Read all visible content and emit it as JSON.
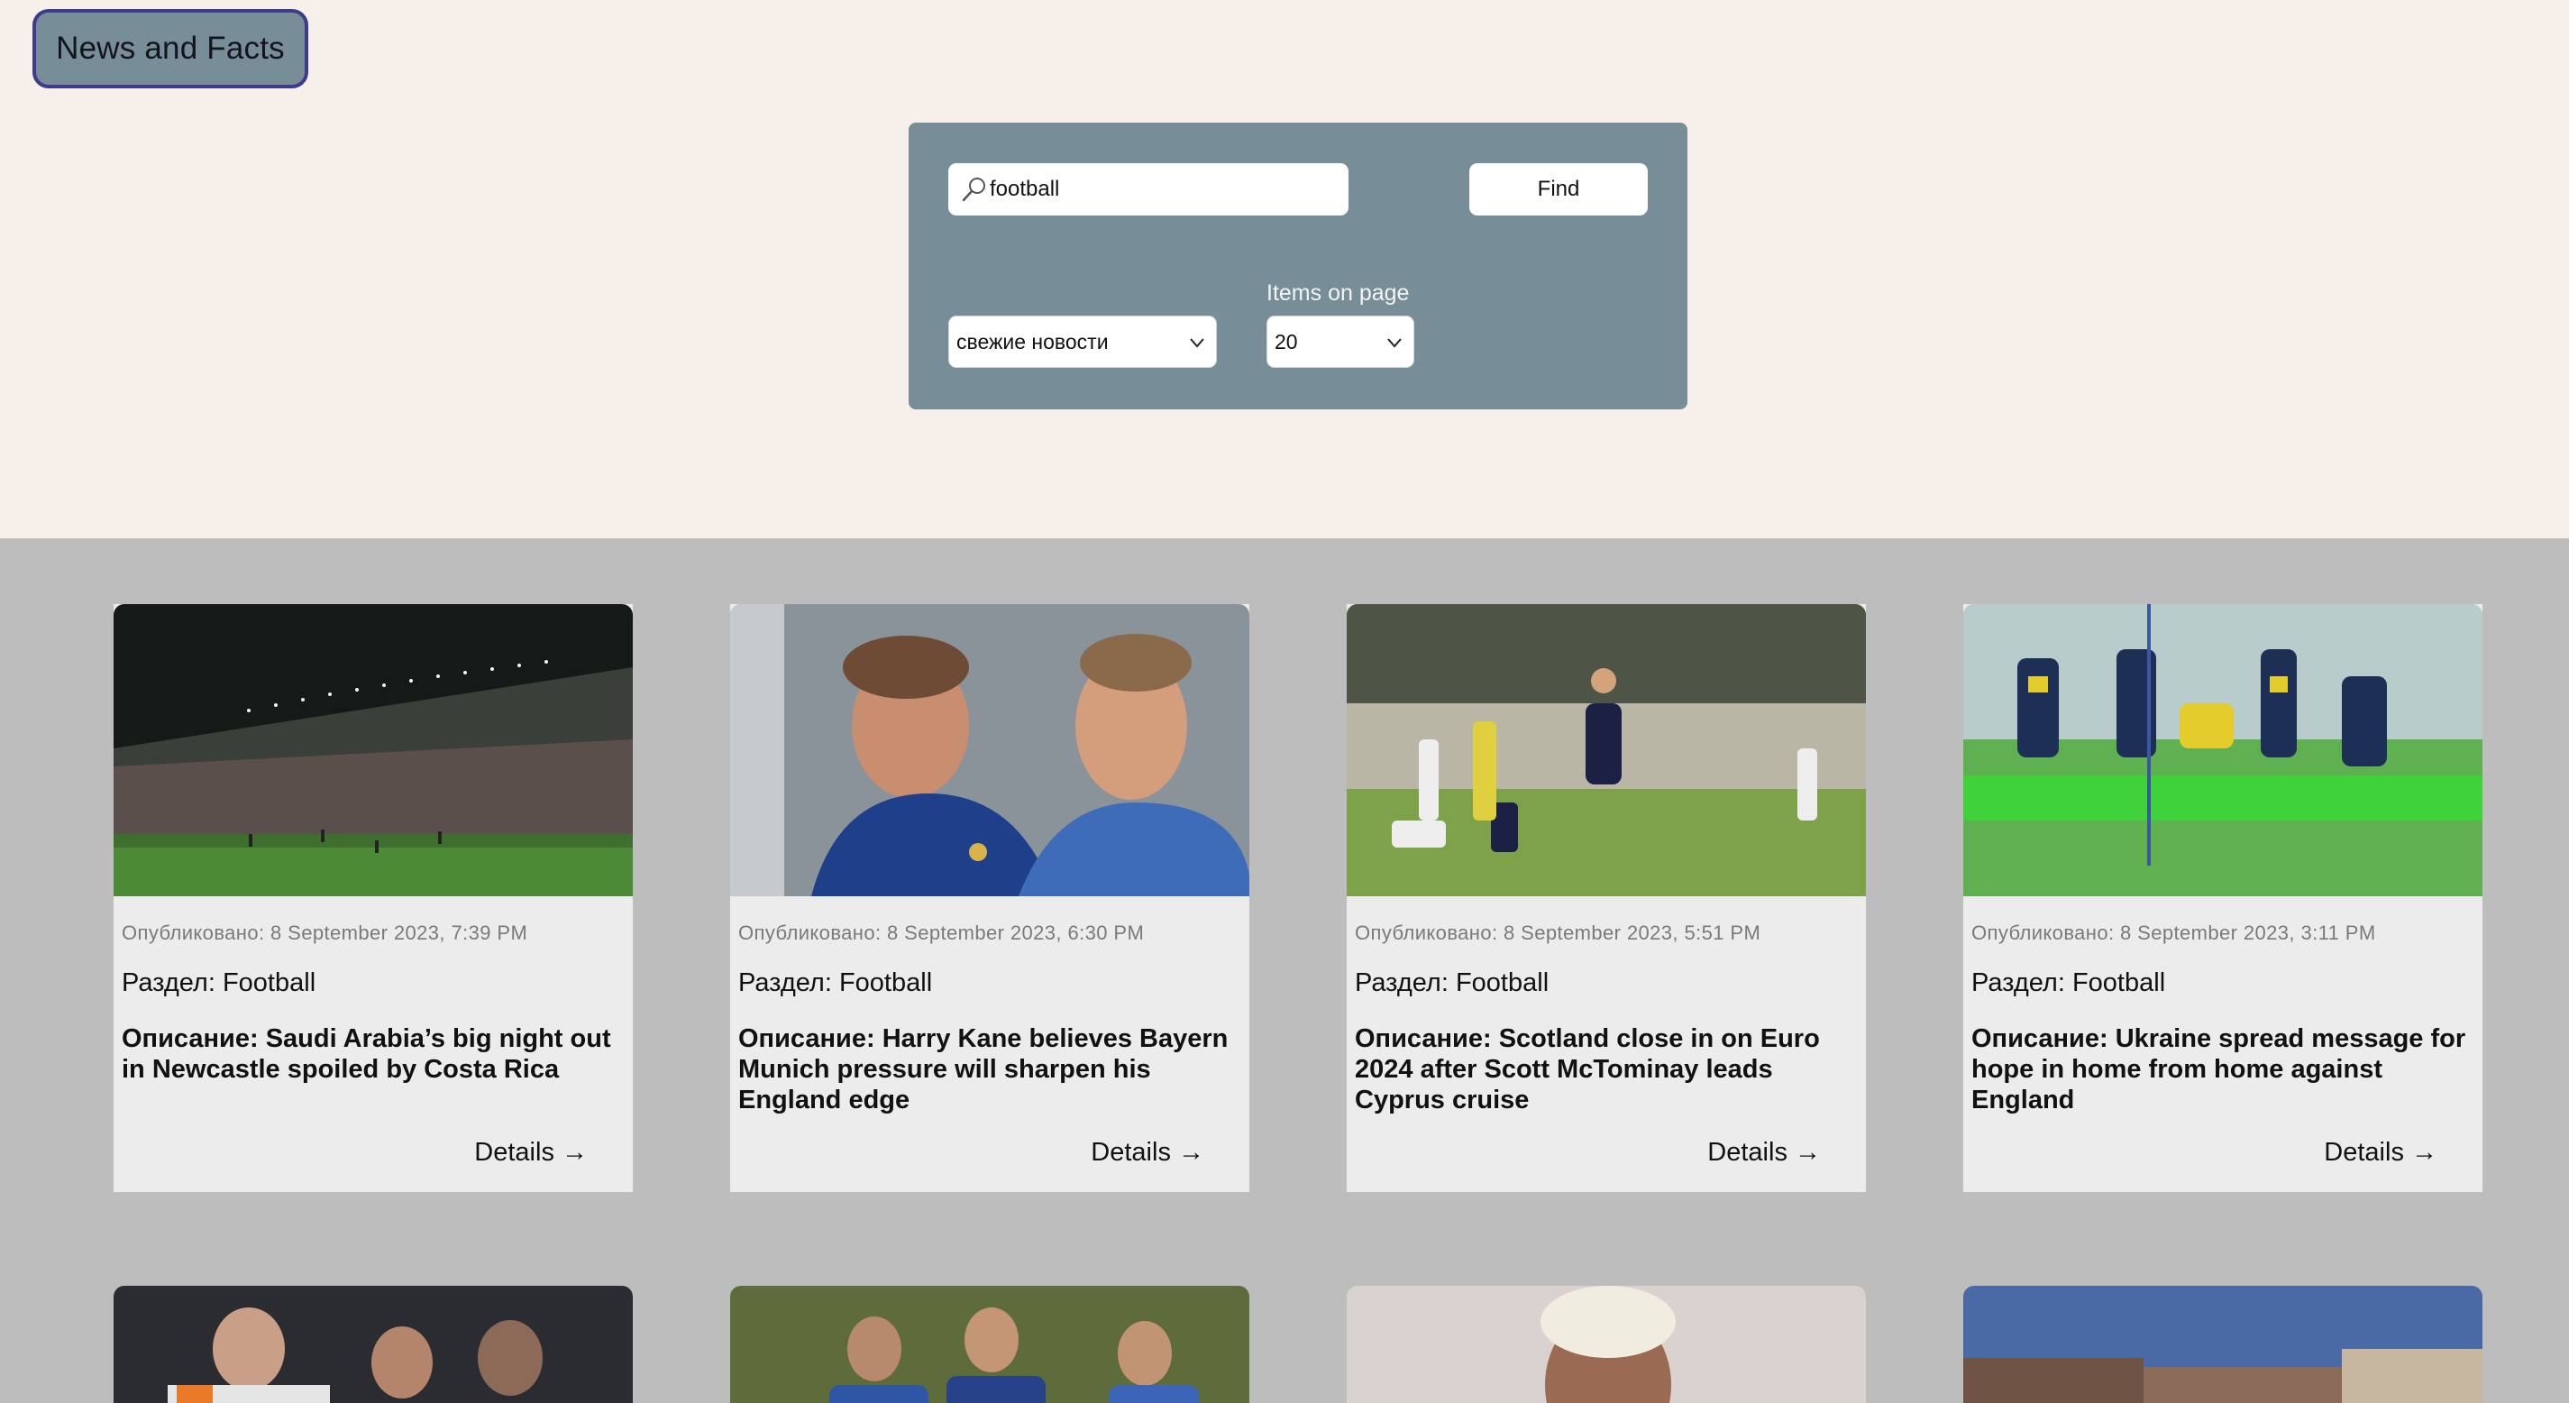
{
  "header": {
    "logo_text": "News and Facts"
  },
  "search": {
    "query_value": "football",
    "find_label": "Find",
    "sort_selected": "свежие новости",
    "items_on_page_label": "Items on page",
    "items_on_page_selected": "20"
  },
  "cards": [
    {
      "published": "Опубликовано: 8 September 2023, 7:39 PM",
      "section": "Раздел: Football",
      "description": "Описание: Saudi Arabia’s big night out in Newcastle spoiled by Costa Rica",
      "details": "Details →"
    },
    {
      "published": "Опубликовано: 8 September 2023, 6:30 PM",
      "section": "Раздел: Football",
      "description": "Описание: Harry Kane believes Bayern Munich pressure will sharpen his England edge",
      "details": "Details →"
    },
    {
      "published": "Опубликовано: 8 September 2023, 5:51 PM",
      "section": "Раздел: Football",
      "description": "Описание: Scotland close in on Euro 2024 after Scott McTominay leads Cyprus cruise",
      "details": "Details →"
    },
    {
      "published": "Опубликовано: 8 September 2023, 3:11 PM",
      "section": "Раздел: Football",
      "description": "Описание: Ukraine spread message for hope in home from home against England",
      "details": "Details →"
    }
  ],
  "colors": {
    "page_background": "#bdbdbd",
    "header_background": "#f7efe9",
    "panel_background": "#778d97",
    "logo_border": "#3d3b8e",
    "card_background": "#ececec"
  }
}
